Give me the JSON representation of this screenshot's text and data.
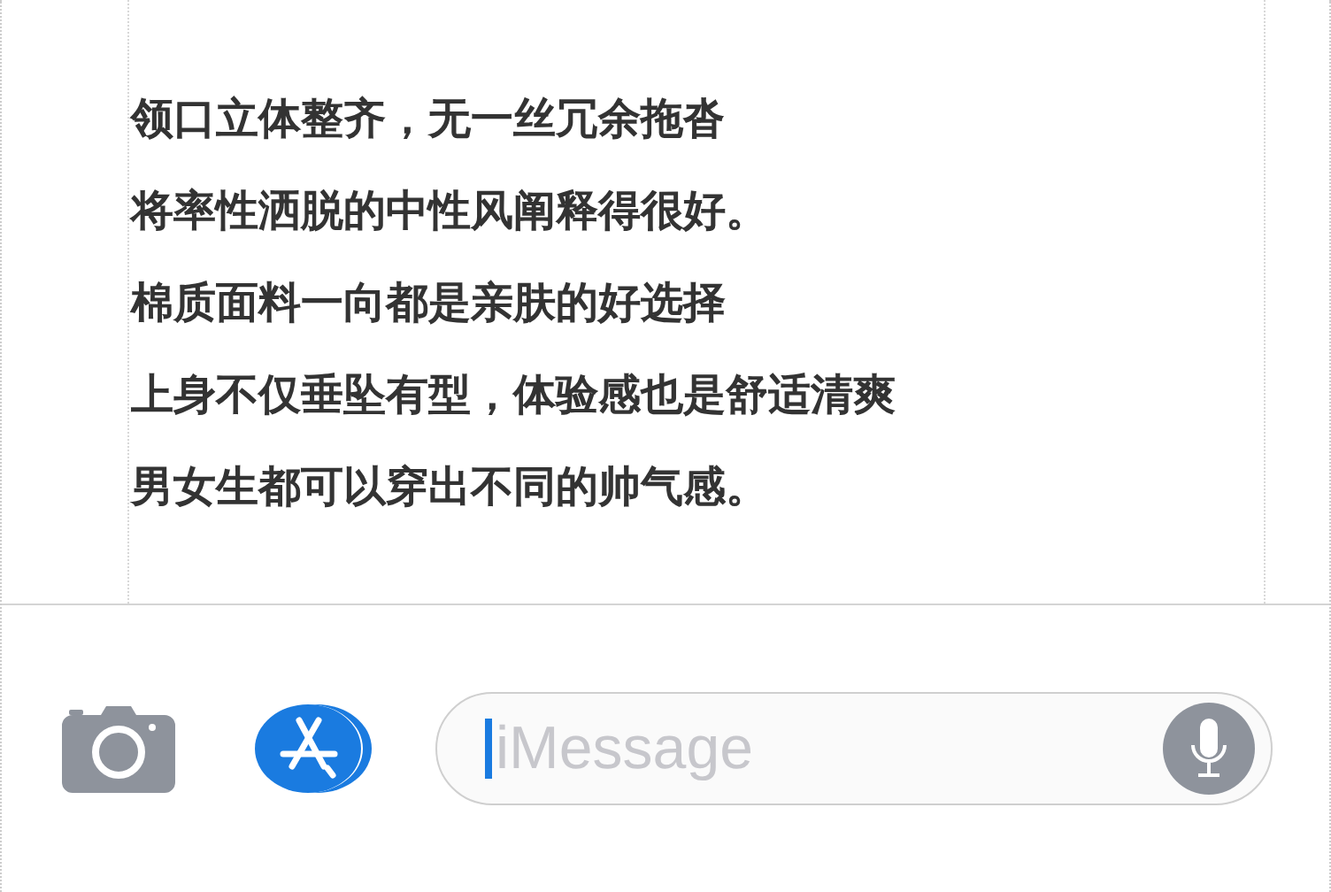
{
  "message_lines": [
    "领口立体整齐，无一丝冗余拖沓",
    "将率性洒脱的中性风阐释得很好。",
    "棉质面料一向都是亲肤的好选择",
    "上身不仅垂坠有型，体验感也是舒适清爽",
    "男女生都可以穿出不同的帅气感。"
  ],
  "compose_bar": {
    "placeholder": "iMessage"
  }
}
